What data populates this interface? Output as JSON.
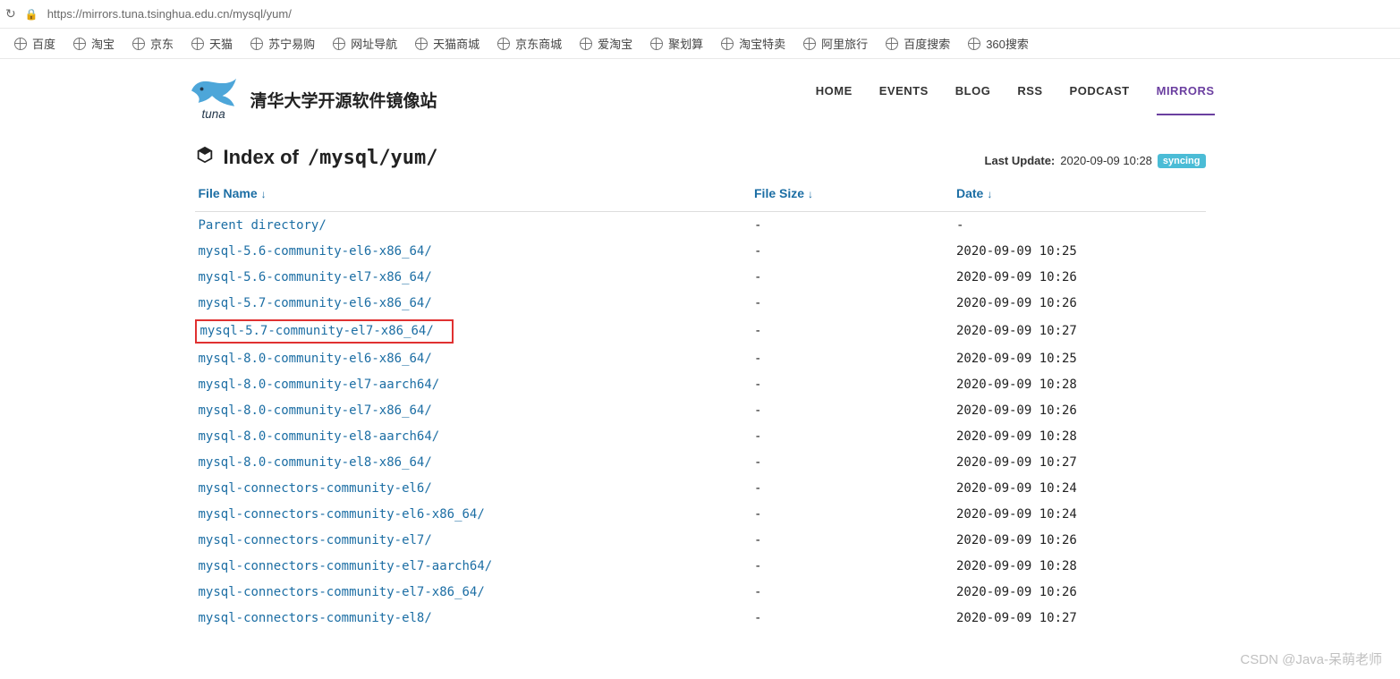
{
  "address_bar": {
    "url": "https://mirrors.tuna.tsinghua.edu.cn/mysql/yum/"
  },
  "bookmarks": [
    "百度",
    "淘宝",
    "京东",
    "天猫",
    "苏宁易购",
    "网址导航",
    "天猫商城",
    "京东商城",
    "爱淘宝",
    "聚划算",
    "淘宝特卖",
    "阿里旅行",
    "百度搜索",
    "360搜索"
  ],
  "brand": {
    "title": "清华大学开源软件镜像站",
    "logo_text": "tuna"
  },
  "nav": [
    {
      "label": "HOME",
      "active": false
    },
    {
      "label": "EVENTS",
      "active": false
    },
    {
      "label": "BLOG",
      "active": false
    },
    {
      "label": "RSS",
      "active": false
    },
    {
      "label": "PODCAST",
      "active": false
    },
    {
      "label": "MIRRORS",
      "active": true
    }
  ],
  "page_title": {
    "prefix": "Index of",
    "path": "/mysql/yum/"
  },
  "last_update": {
    "label": "Last Update:",
    "value": "2020-09-09 10:28",
    "badge": "syncing"
  },
  "columns": {
    "name": "File Name",
    "size": "File Size",
    "date": "Date",
    "arrow": "↓"
  },
  "files": [
    {
      "name": "Parent directory/",
      "size": "-",
      "date": "-",
      "highlight": false
    },
    {
      "name": "mysql-5.6-community-el6-x86_64/",
      "size": "-",
      "date": "2020-09-09 10:25",
      "highlight": false
    },
    {
      "name": "mysql-5.6-community-el7-x86_64/",
      "size": "-",
      "date": "2020-09-09 10:26",
      "highlight": false
    },
    {
      "name": "mysql-5.7-community-el6-x86_64/",
      "size": "-",
      "date": "2020-09-09 10:26",
      "highlight": false
    },
    {
      "name": "mysql-5.7-community-el7-x86_64/",
      "size": "-",
      "date": "2020-09-09 10:27",
      "highlight": true
    },
    {
      "name": "mysql-8.0-community-el6-x86_64/",
      "size": "-",
      "date": "2020-09-09 10:25",
      "highlight": false
    },
    {
      "name": "mysql-8.0-community-el7-aarch64/",
      "size": "-",
      "date": "2020-09-09 10:28",
      "highlight": false
    },
    {
      "name": "mysql-8.0-community-el7-x86_64/",
      "size": "-",
      "date": "2020-09-09 10:26",
      "highlight": false
    },
    {
      "name": "mysql-8.0-community-el8-aarch64/",
      "size": "-",
      "date": "2020-09-09 10:28",
      "highlight": false
    },
    {
      "name": "mysql-8.0-community-el8-x86_64/",
      "size": "-",
      "date": "2020-09-09 10:27",
      "highlight": false
    },
    {
      "name": "mysql-connectors-community-el6/",
      "size": "-",
      "date": "2020-09-09 10:24",
      "highlight": false
    },
    {
      "name": "mysql-connectors-community-el6-x86_64/",
      "size": "-",
      "date": "2020-09-09 10:24",
      "highlight": false
    },
    {
      "name": "mysql-connectors-community-el7/",
      "size": "-",
      "date": "2020-09-09 10:26",
      "highlight": false
    },
    {
      "name": "mysql-connectors-community-el7-aarch64/",
      "size": "-",
      "date": "2020-09-09 10:28",
      "highlight": false
    },
    {
      "name": "mysql-connectors-community-el7-x86_64/",
      "size": "-",
      "date": "2020-09-09 10:26",
      "highlight": false
    },
    {
      "name": "mysql-connectors-community-el8/",
      "size": "-",
      "date": "2020-09-09 10:27",
      "highlight": false
    }
  ],
  "watermark": "CSDN @Java-呆萌老师"
}
